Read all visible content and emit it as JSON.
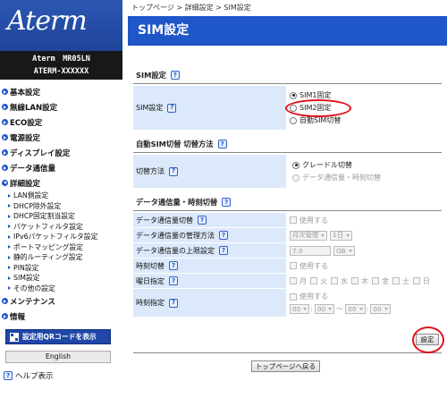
{
  "sidebar": {
    "logo": "Aterm",
    "device_model": "Aterm　MR05LN",
    "device_name": "ATERM-XXXXXX",
    "nav": [
      {
        "label": "基本設定"
      },
      {
        "label": "無線LAN設定"
      },
      {
        "label": "ECO設定"
      },
      {
        "label": "電源設定"
      },
      {
        "label": "ディスプレイ設定"
      },
      {
        "label": "データ通信量"
      },
      {
        "label": "詳細設定"
      }
    ],
    "sub_items": [
      {
        "label": "LAN側設定"
      },
      {
        "label": "DHCP除外設定"
      },
      {
        "label": "DHCP固定割当設定"
      },
      {
        "label": "パケットフィルタ設定"
      },
      {
        "label": "IPv6パケットフィルタ設定"
      },
      {
        "label": "ポートマッピング設定"
      },
      {
        "label": "静的ルーティング設定"
      },
      {
        "label": "PIN設定"
      },
      {
        "label": "SIM設定"
      },
      {
        "label": "その他の設定"
      }
    ],
    "nav_bottom": [
      {
        "label": "メンテナンス"
      },
      {
        "label": "情報"
      }
    ],
    "qr_button": "設定用QRコードを表示",
    "language_button": "English",
    "help_link": "ヘルプ表示"
  },
  "main": {
    "breadcrumb": "トップページ > 詳細設定 > SIM設定",
    "page_title": "SIM設定",
    "help_glyph": "?",
    "sim_section": {
      "heading": "SIM設定",
      "label": "SIM設定",
      "options": [
        "SIM1固定",
        "SIM2固定",
        "自動SIM切替"
      ],
      "selected": "SIM1固定"
    },
    "auto_switch_section": {
      "heading": "自動SIM切替 切替方法",
      "label": "切替方法",
      "options": [
        "クレードル切替",
        "データ通信量・時刻切替"
      ],
      "selected": "クレードル切替"
    },
    "data_section": {
      "heading": "データ通信量・時刻切替",
      "rows": {
        "data_switch_label": "データ通信量切替",
        "data_switch_check": "使用する",
        "mgmt_label": "データ通信量の管理方法",
        "mgmt_method": "月次管理",
        "mgmt_day": "1日",
        "limit_label": "データ通信量の上限設定",
        "limit_value": "7.0",
        "limit_unit": "GB",
        "time_switch_label": "時刻切替",
        "time_switch_check": "使用する",
        "weekday_label": "曜日指定",
        "weekdays": [
          "月",
          "火",
          "水",
          "木",
          "金",
          "土",
          "日"
        ],
        "time_label": "時刻指定",
        "time_check": "使用する",
        "time_from_h": "00",
        "time_from_m": "00",
        "time_sep": "〜",
        "time_to_h": "00",
        "time_to_m": "00"
      }
    },
    "set_button": "設定",
    "back_button": "トップページへ戻る"
  }
}
